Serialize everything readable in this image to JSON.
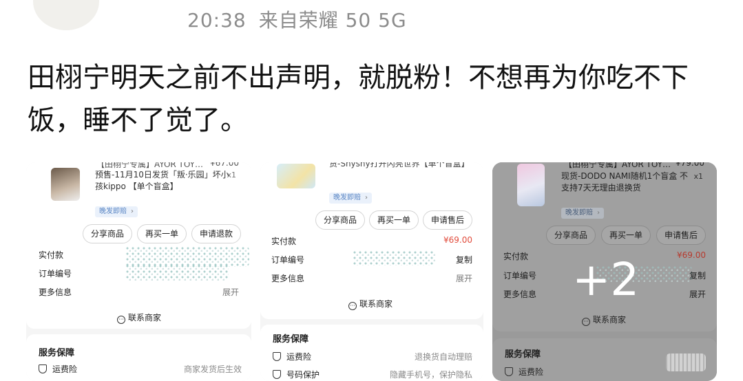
{
  "post": {
    "time": "20:38",
    "source": "来自荣耀 50 5G",
    "text": "田栩宁明天之前不出声明，就脱粉！不想再为你吃不下饭，睡不了觉了。"
  },
  "screenshots": [
    {
      "clipped_title": "【田栩宁专属】AYOR TOY…",
      "clipped_price": "¥67.00",
      "description": "预售-11月10日发货「叛·乐园」坏小孩kippo 【单个盲盒】",
      "qty": "x1",
      "tag": "晚发即赔",
      "buttons": [
        "分享商品",
        "再买一单",
        "申请退款"
      ],
      "rows": [
        {
          "label": "实付款",
          "value": ""
        },
        {
          "label": "订单编号",
          "value": ""
        },
        {
          "label": "更多信息",
          "value": "展开"
        }
      ],
      "contact": "联系商家",
      "service_title": "服务保障",
      "services": [
        {
          "label": "运费险",
          "value": "商家发货后生效"
        }
      ]
    },
    {
      "description": "货-Shyshy打开闪亮世界【单个盲盒】",
      "tag": "晚发即赔",
      "buttons": [
        "分享商品",
        "再买一单",
        "申请售后"
      ],
      "rows": [
        {
          "label": "实付款",
          "value": "¥69.00"
        },
        {
          "label": "订单编号",
          "value": "复制"
        },
        {
          "label": "更多信息",
          "value": "展开"
        }
      ],
      "contact": "联系商家",
      "service_title": "服务保障",
      "services": [
        {
          "label": "运费险",
          "value": "退换货自动理赔"
        },
        {
          "label": "号码保护",
          "value": "隐藏手机号，保护隐私"
        }
      ]
    },
    {
      "clipped_title": "【田栩宁专属】AYOR TOY…",
      "clipped_price": "¥79.00",
      "description": "现货-DODO NAMI随机1个盲盒 不支持7天无理由退换货",
      "qty": "x1",
      "tag": "晚发即赔",
      "buttons": [
        "分享商品",
        "再买一单",
        "申请售后"
      ],
      "rows": [
        {
          "label": "实付款",
          "value": "¥69.00"
        },
        {
          "label": "订单编号",
          "value": "复制"
        },
        {
          "label": "更多信息",
          "value": "展开"
        }
      ],
      "contact": "联系商家",
      "service_title": "服务保障",
      "services": [
        {
          "label": "运费险",
          "value": ""
        }
      ],
      "more_count": "+2"
    }
  ]
}
